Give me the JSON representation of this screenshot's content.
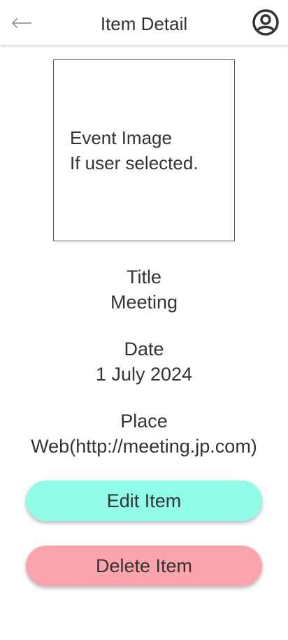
{
  "header": {
    "title": "Item Detail",
    "back_icon": "arrow-left-icon",
    "profile_icon": "user-circle-icon"
  },
  "image_placeholder": {
    "line1": "Event Image",
    "line2": "If user selected."
  },
  "details": {
    "title_label": "Title",
    "title_value": "Meeting",
    "date_label": "Date",
    "date_value": "1 July 2024",
    "place_label": "Place",
    "place_value": "Web(http://meeting.jp.com)"
  },
  "actions": {
    "edit_label": "Edit Item",
    "delete_label": "Delete Item"
  },
  "colors": {
    "edit_button": "#8ffbe8",
    "delete_button": "#fca4ad",
    "text": "#333333"
  }
}
